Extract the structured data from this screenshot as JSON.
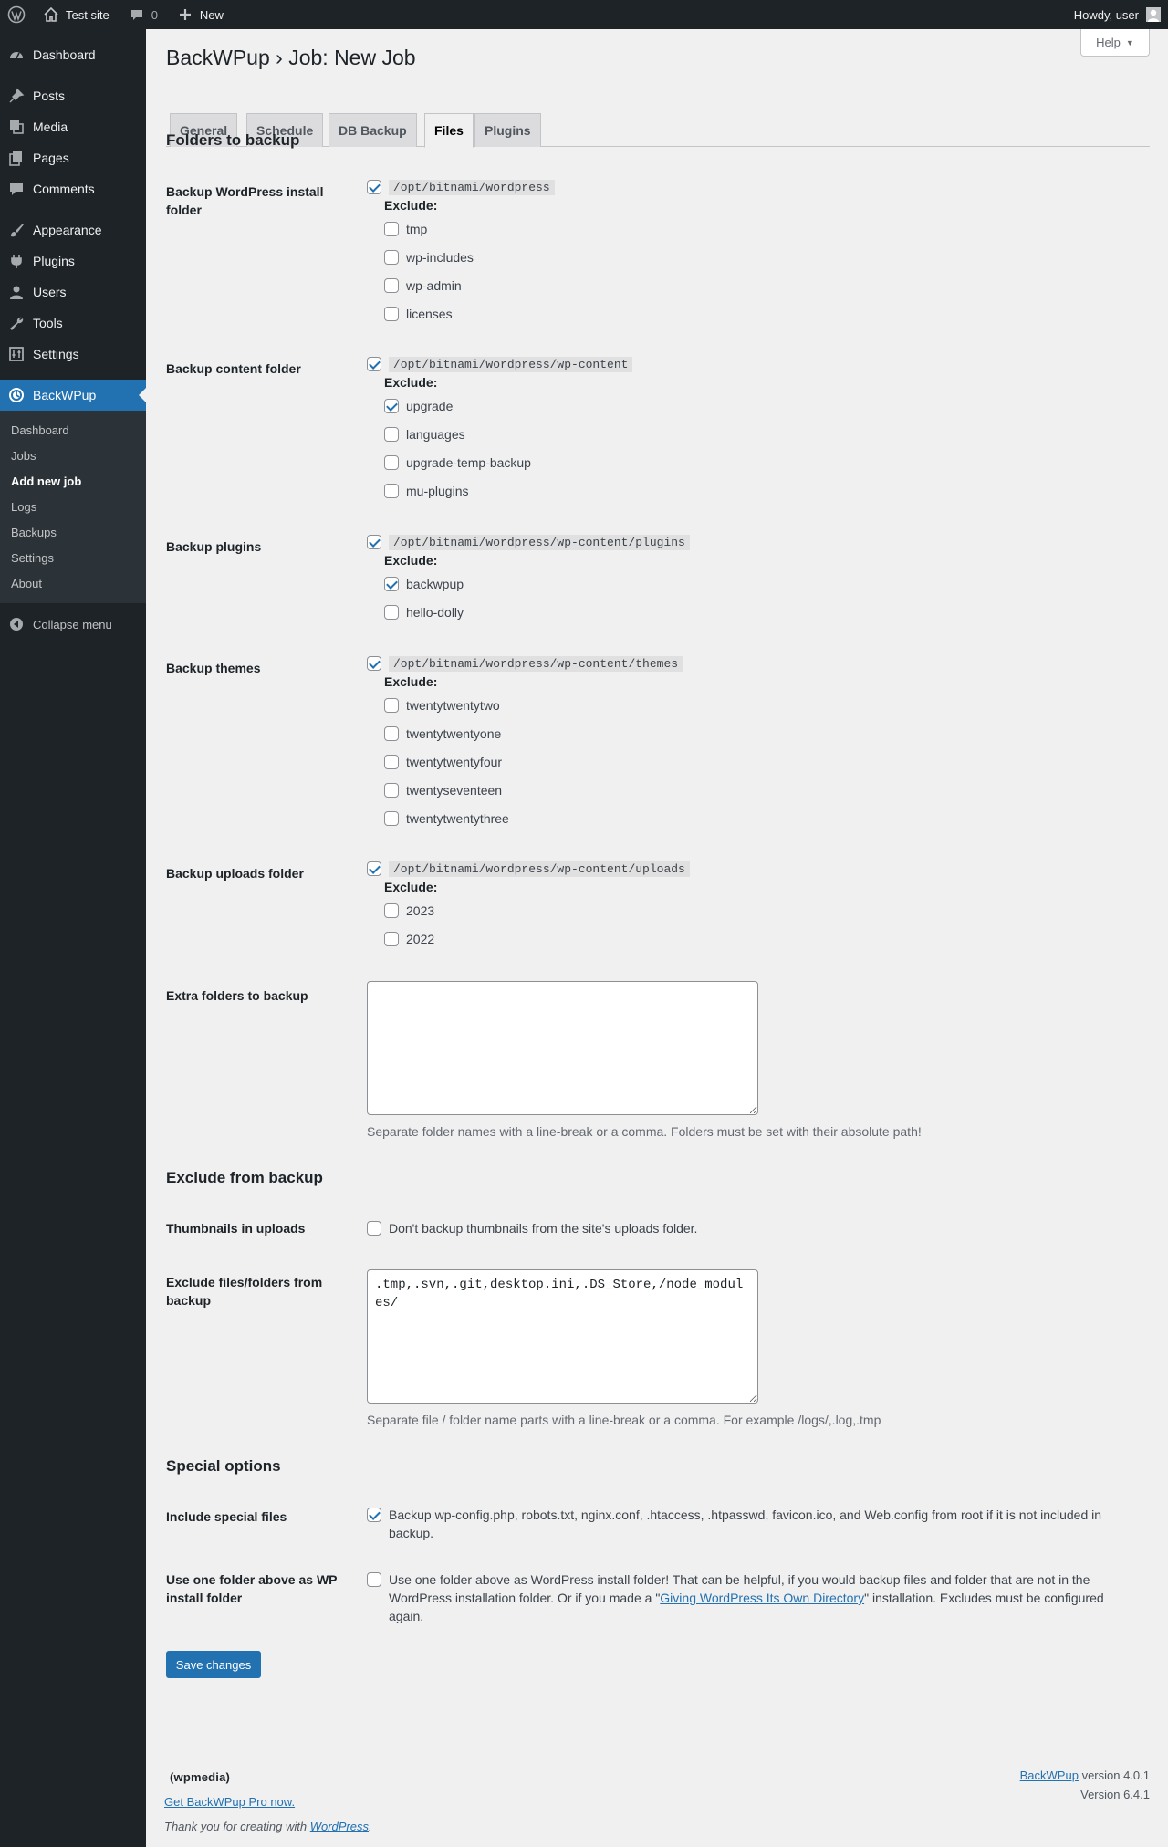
{
  "adminbar": {
    "site_name": "Test site",
    "comments_count": "0",
    "new_label": "New",
    "howdy": "Howdy, user"
  },
  "sidebar": {
    "items": [
      {
        "label": "Dashboard",
        "icon": "dashboard-icon"
      },
      {
        "label": "Posts",
        "icon": "pin-icon"
      },
      {
        "label": "Media",
        "icon": "media-icon"
      },
      {
        "label": "Pages",
        "icon": "pages-icon"
      },
      {
        "label": "Comments",
        "icon": "comment-icon"
      },
      {
        "label": "Appearance",
        "icon": "brush-icon"
      },
      {
        "label": "Plugins",
        "icon": "plug-icon"
      },
      {
        "label": "Users",
        "icon": "user-icon"
      },
      {
        "label": "Tools",
        "icon": "wrench-icon"
      },
      {
        "label": "Settings",
        "icon": "settings-icon"
      }
    ],
    "current": {
      "label": "BackWPup",
      "icon": "backwpup-icon"
    },
    "submenu": [
      "Dashboard",
      "Jobs",
      "Add new job",
      "Logs",
      "Backups",
      "Settings",
      "About"
    ],
    "submenu_active": "Add new job",
    "collapse": "Collapse menu"
  },
  "page": {
    "title": "BackWPup › Job: New Job",
    "help": "Help",
    "tabs": [
      "General",
      "Schedule",
      "DB Backup",
      "Files",
      "Plugins"
    ],
    "active_tab": "Files"
  },
  "folders": {
    "heading": "Folders to backup",
    "exclude_label": "Exclude:",
    "groups": [
      {
        "label": "Backup WordPress install folder",
        "path": "/opt/bitnami/wordpress",
        "checked": true,
        "excludes": [
          {
            "name": "tmp",
            "checked": false
          },
          {
            "name": "wp-includes",
            "checked": false
          },
          {
            "name": "wp-admin",
            "checked": false
          },
          {
            "name": "licenses",
            "checked": false
          }
        ]
      },
      {
        "label": "Backup content folder",
        "path": "/opt/bitnami/wordpress/wp-content",
        "checked": true,
        "excludes": [
          {
            "name": "upgrade",
            "checked": true
          },
          {
            "name": "languages",
            "checked": false
          },
          {
            "name": "upgrade-temp-backup",
            "checked": false
          },
          {
            "name": "mu-plugins",
            "checked": false
          }
        ]
      },
      {
        "label": "Backup plugins",
        "path": "/opt/bitnami/wordpress/wp-content/plugins",
        "checked": true,
        "excludes": [
          {
            "name": "backwpup",
            "checked": true
          },
          {
            "name": "hello-dolly",
            "checked": false
          }
        ]
      },
      {
        "label": "Backup themes",
        "path": "/opt/bitnami/wordpress/wp-content/themes",
        "checked": true,
        "excludes": [
          {
            "name": "twentytwentytwo",
            "checked": false
          },
          {
            "name": "twentytwentyone",
            "checked": false
          },
          {
            "name": "twentytwentyfour",
            "checked": false
          },
          {
            "name": "twentyseventeen",
            "checked": false
          },
          {
            "name": "twentytwentythree",
            "checked": false
          }
        ]
      },
      {
        "label": "Backup uploads folder",
        "path": "/opt/bitnami/wordpress/wp-content/uploads",
        "checked": true,
        "excludes": [
          {
            "name": "2023",
            "checked": false
          },
          {
            "name": "2022",
            "checked": false
          }
        ]
      }
    ],
    "extra_label": "Extra folders to backup",
    "extra_value": "",
    "extra_desc": "Separate folder names with a line-break or a comma. Folders must be set with their absolute path!"
  },
  "exclude": {
    "heading": "Exclude from backup",
    "thumbs_label": "Thumbnails in uploads",
    "thumbs_text": "Don't backup thumbnails from the site's uploads folder.",
    "thumbs_checked": false,
    "files_label": "Exclude files/folders from backup",
    "files_value": ".tmp,.svn,.git,desktop.ini,.DS_Store,/node_modules/",
    "files_desc": "Separate file / folder name parts with a line-break or a comma. For example /logs/,.log,.tmp"
  },
  "special": {
    "heading": "Special options",
    "include_label": "Include special files",
    "include_text": "Backup wp-config.php, robots.txt, nginx.conf, .htaccess, .htpasswd, favicon.ico, and Web.config from root if it is not included in backup.",
    "include_checked": true,
    "above_label": "Use one folder above as WP install folder",
    "above_text_1": "Use one folder above as WordPress install folder! That can be helpful, if you would backup files and folder that are not in the WordPress installation folder. Or if you made a \"",
    "above_link": "Giving WordPress Its Own Directory",
    "above_text_2": "\" installation. Excludes must be configured again.",
    "above_checked": false
  },
  "save_label": "Save changes",
  "footer": {
    "logo": "(wpmedia)",
    "pro_link": "Get BackWPup Pro now.",
    "thanks_1": "Thank you for creating with ",
    "thanks_link": "WordPress",
    "thanks_2": ".",
    "plugin_link": "BackWPup",
    "plugin_version": " version 4.0.1",
    "wp_version": "Version 6.4.1"
  }
}
